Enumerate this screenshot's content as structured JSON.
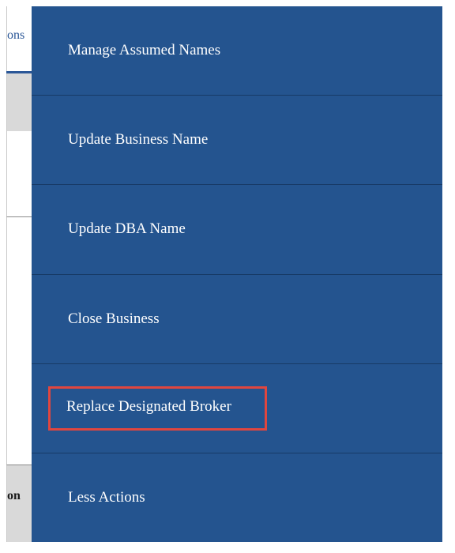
{
  "background": {
    "tab_fragment": "ons",
    "column_fragment": "on"
  },
  "menu": {
    "items": [
      {
        "label": "Manage Assumed Names"
      },
      {
        "label": "Update Business Name"
      },
      {
        "label": "Update DBA Name"
      },
      {
        "label": "Close Business"
      },
      {
        "label": "Replace Designated Broker",
        "highlighted": true
      },
      {
        "label": "Less Actions"
      }
    ]
  },
  "colors": {
    "menu_background": "#24548f",
    "highlight_outline": "#e0463f",
    "tab_text": "#2b5797"
  }
}
